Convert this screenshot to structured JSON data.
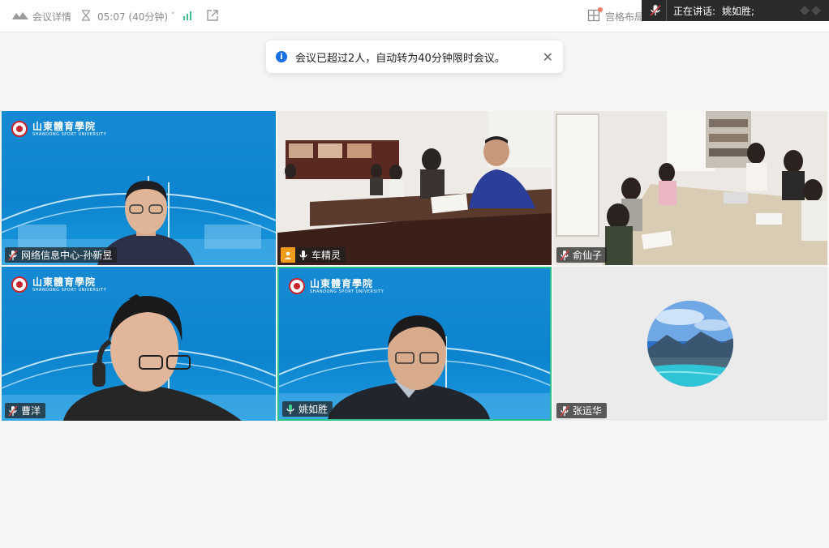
{
  "topbar": {
    "meeting_details_label": "会议详情",
    "timer_text": "05:07 (40分钟)",
    "layout_label": "宫格布局"
  },
  "speaker": {
    "label": "正在讲话:",
    "name": "姚如胜;"
  },
  "toast": {
    "message": "会议已超过2人，自动转为40分钟限时会议。"
  },
  "school": {
    "name_cn": "山東體育學院",
    "name_en": "SHANDONG SPORT UNIVERSITY"
  },
  "participants": [
    {
      "name": "网络信息中心-孙新昱",
      "mic": "muted",
      "background": "blue"
    },
    {
      "name": "车精灵",
      "mic": "on",
      "host_badge": true,
      "background": "room"
    },
    {
      "name": "俞仙子",
      "mic": "muted",
      "background": "room"
    },
    {
      "name": "曹洋",
      "mic": "muted",
      "background": "blue"
    },
    {
      "name": "姚如胜",
      "mic": "speaking",
      "active": true,
      "background": "blue"
    },
    {
      "name": "张运华",
      "mic": "muted",
      "background": "avatar"
    }
  ],
  "colors": {
    "accent": "#1a6ee6",
    "active_border": "#2ec08a",
    "tile_blue": "#0d84cf",
    "host_badge": "#f29a1a"
  },
  "icons": [
    "cloud-logo-icon",
    "hourglass-icon",
    "signal-icon",
    "popout-icon",
    "grid-layout-icon",
    "mic-muted-icon",
    "mic-icon",
    "user-icon",
    "info-icon",
    "close-icon"
  ]
}
